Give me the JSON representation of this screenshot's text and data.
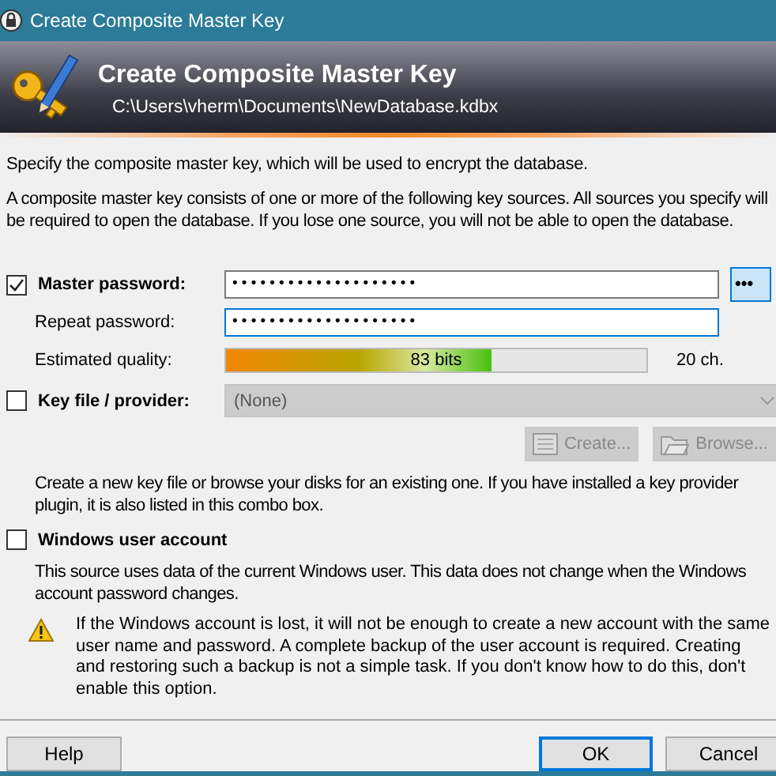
{
  "window": {
    "title": "Create Composite Master Key"
  },
  "banner": {
    "title": "Create Composite Master Key",
    "path": "C:\\Users\\vherm\\Documents\\NewDatabase.kdbx"
  },
  "intro": "Specify the composite master key, which will be used to encrypt the database.",
  "description": "A composite master key consists of one or more of the following key sources. All sources you specify will be required to open the database.  If you lose one source, you will not be able to open the database.",
  "master_password": {
    "label": "Master password:",
    "checked": true,
    "value": "••••••••••••••••••••",
    "toggle": "•••"
  },
  "repeat_password": {
    "label": "Repeat password:",
    "value": "••••••••••••••••••••"
  },
  "quality": {
    "label": "Estimated quality:",
    "level": 0.63,
    "reading": "83 bits",
    "length": "20 ch."
  },
  "key_file": {
    "label": "Key file / provider:",
    "checked": false,
    "value": "(None)",
    "create": "Create...",
    "browse": "Browse...",
    "note": "Create a new key file or browse your disks for an existing one. If you have installed a key provider plugin, it is also listed in this combo box."
  },
  "windows_account": {
    "label": "Windows user account",
    "checked": false,
    "note": "This source uses data of the current Windows user. This data does not change when the Windows account password changes.",
    "warning": "If the Windows account is lost, it will not be enough to create a new account with the same user name and password. A complete backup of the user account is required. Creating and restoring such a backup is not a simple task. If you don't know how to do this, don't enable this option."
  },
  "buttons": {
    "help": "Help",
    "ok": "OK",
    "cancel": "Cancel"
  }
}
